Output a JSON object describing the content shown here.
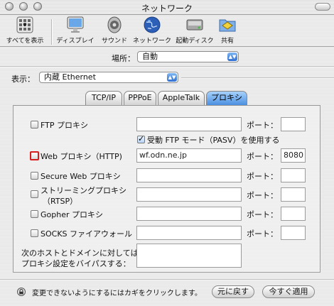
{
  "window": {
    "title": "ネットワーク"
  },
  "toolbar": {
    "items": [
      {
        "label": "すべてを表示",
        "icon": "apple-icon"
      },
      {
        "label": "ディスプレイ",
        "icon": "display-icon"
      },
      {
        "label": "サウンド",
        "icon": "speaker-icon"
      },
      {
        "label": "ネットワーク",
        "icon": "globe-icon"
      },
      {
        "label": "起動ディスク",
        "icon": "disk-icon"
      },
      {
        "label": "共有",
        "icon": "sharing-folder-icon"
      }
    ]
  },
  "location": {
    "label": "場所：",
    "value": "自動"
  },
  "show": {
    "label": "表示：",
    "value": "内蔵 Ethernet"
  },
  "tabs": [
    {
      "label": "TCP/IP"
    },
    {
      "label": "PPPoE"
    },
    {
      "label": "AppleTalk"
    },
    {
      "label": "プロキシ",
      "selected": true
    }
  ],
  "proxies": {
    "port_label": "ポート：",
    "ftp": {
      "label": "FTP プロキシ",
      "checked": false,
      "server": "",
      "port": ""
    },
    "pasv": {
      "label": "受動 FTP モード（PASV）を使用する",
      "checked": true
    },
    "web": {
      "label": "Web プロキシ（HTTP)",
      "checked": false,
      "server": "wf.odn.ne.jp",
      "port": "8080"
    },
    "secure_web": {
      "label": "Secure Web プロキシ",
      "checked": false,
      "server": "",
      "port": ""
    },
    "streaming": {
      "label_line1": "ストリーミングプロキシ",
      "label_line2": "（RTSP）",
      "checked": false,
      "server": "",
      "port": ""
    },
    "gopher": {
      "label": "Gopher プロキシ",
      "checked": false,
      "server": "",
      "port": ""
    },
    "socks": {
      "label": "SOCKS ファイアウォール",
      "checked": false,
      "server": "",
      "port": ""
    },
    "bypass": {
      "label_line1": "次のホストとドメインに対しては",
      "label_line2": "プロキシ設定をバイパスする：",
      "value": ""
    }
  },
  "footer": {
    "lock_text": "変更できないようにするにはカギをクリックします。",
    "revert_label": "元に戻す",
    "apply_label": "今すぐ適用"
  }
}
